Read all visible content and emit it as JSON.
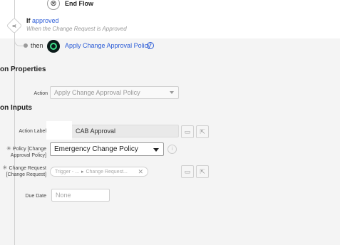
{
  "flow": {
    "end_flow_label": "End Flow",
    "if_keyword": "If",
    "if_condition": "approved",
    "if_description": "When the Change Request is Approved",
    "then_label": "then",
    "action_link": "Apply Change Approval Policy"
  },
  "properties": {
    "title": "on Properties",
    "action_label": "Action",
    "action_value": "Apply Change Approval Policy"
  },
  "inputs": {
    "title": "on Inputs",
    "action_label_label": "Action Label",
    "action_label_value": "CAB Approval",
    "policy_label": "Policy [Change Approval Policy]",
    "policy_value": "Emergency Change Policy",
    "change_request_label": "Change Request [Change Request]",
    "pill_trigger": "Trigger - ...",
    "pill_change": "Change Request...",
    "due_date_label": "Due Date",
    "due_date_placeholder": "None"
  },
  "icons": {
    "end": "close-circle-icon",
    "branch": "branch-icon",
    "action": "action-target-icon",
    "help": "help-circle-icon",
    "calendar": "calendar-icon",
    "pill": "data-pill-picker-icon",
    "info": "info-icon",
    "clear": "clear-icon"
  },
  "colors": {
    "link": "#2a5bd7",
    "action_ring": "#3ee08a",
    "panel_bg": "#f4f4f4"
  }
}
